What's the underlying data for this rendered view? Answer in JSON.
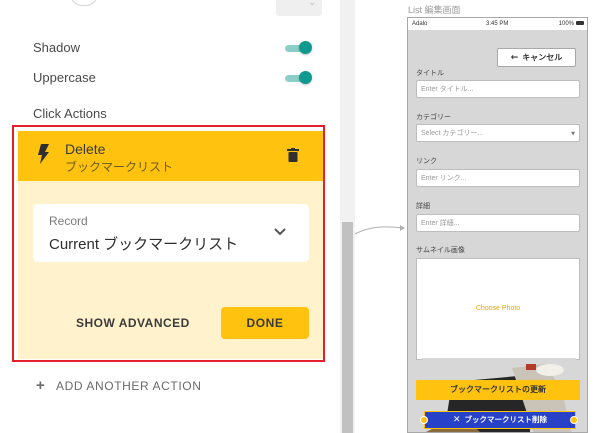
{
  "props": {
    "shadow_label": "Shadow",
    "shadow_on": true,
    "uppercase_label": "Uppercase",
    "uppercase_on": true,
    "click_actions_label": "Click Actions"
  },
  "action": {
    "title": "Delete",
    "subtitle": "ブックマークリスト",
    "record_label": "Record",
    "record_value": "Current ブックマークリスト",
    "show_advanced": "SHOW ADVANCED",
    "done": "DONE"
  },
  "add_action": "ADD ANOTHER ACTION",
  "canvas": {
    "screen_title": "List 編集画面",
    "status": {
      "carrier": "Adalo",
      "time": "3:45 PM",
      "battery": "100%"
    },
    "cancel_label": "キャンセル",
    "fields": [
      {
        "label": "タイトル",
        "placeholder": "Enter タイトル..."
      },
      {
        "label": "カテゴリー",
        "placeholder": "Select カテゴリー..."
      },
      {
        "label": "リンク",
        "placeholder": "Enter リンク..."
      },
      {
        "label": "詳細",
        "placeholder": "Enter 詳細..."
      }
    ],
    "thumb_label": "サムネイル画像",
    "choose_photo": "Choose Photo",
    "update_label": "ブックマークリストの更新",
    "delete_label": "ブックマークリスト削除"
  },
  "colors": {
    "accent_yellow": "#ffc20e",
    "toggle_teal": "#0f9a8f",
    "highlight_red": "#e3202a",
    "delete_blue": "#2741c9"
  },
  "icons": {
    "action": "lightning-bolt-icon",
    "remove": "trash-icon",
    "dropdown": "chevron-down-icon",
    "add": "plus-icon",
    "back": "arrow-left-icon",
    "close": "x-icon"
  }
}
